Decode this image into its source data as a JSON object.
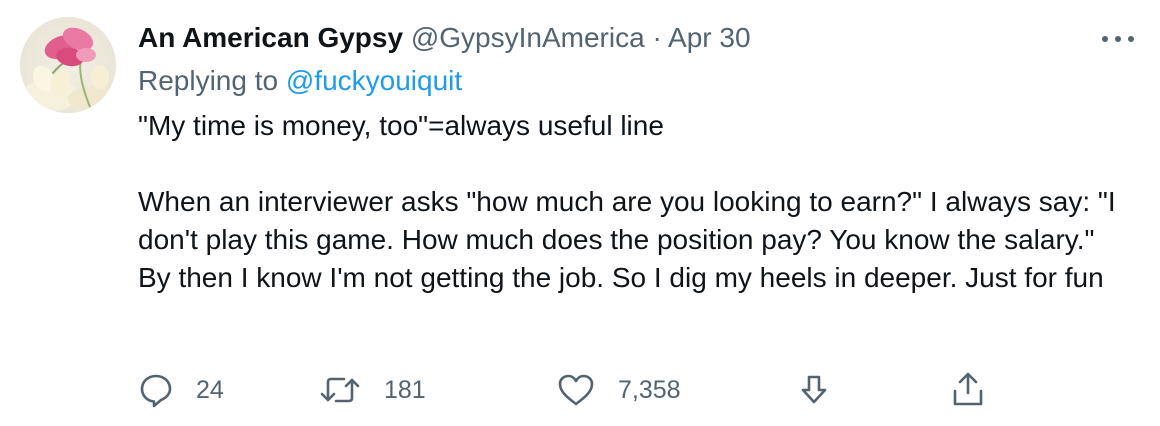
{
  "tweet": {
    "display_name": "An American Gypsy",
    "handle": "@GypsyInAmerica",
    "separator": "·",
    "date": "Apr 30",
    "replying_prefix": "Replying to",
    "replying_to": "@fuckyouiquit",
    "paragraphs": [
      "\"My time is money, too\"=always useful line",
      "When an interviewer asks \"how much are you looking to earn?\" I always say: \"I don't play this game. How much does the position pay? You know the salary.\" By then I know I'm not getting the job. So I dig my heels in deeper. Just for fun"
    ]
  },
  "actions": {
    "reply": {
      "icon": "reply-icon",
      "count": "24"
    },
    "retweet": {
      "icon": "retweet-icon",
      "count": "181"
    },
    "like": {
      "icon": "heart-icon",
      "count": "7,358"
    },
    "download": {
      "icon": "download-icon"
    },
    "share": {
      "icon": "share-icon"
    }
  },
  "colors": {
    "text": "#0f1419",
    "muted": "#536471",
    "link": "#1d9bf0"
  }
}
